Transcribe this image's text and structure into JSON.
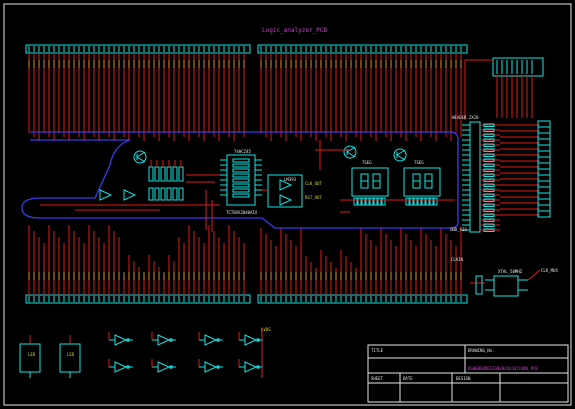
{
  "schematic": {
    "title": "Logic_analyzer_PCB",
    "ic_labels": {
      "u1": "74HC245",
      "u1_part": "TCT8XX2040AIX",
      "comparator": "LM393",
      "display_1": "7SEG",
      "display_2": "7SEG",
      "connector_right": "HEADER 2X20",
      "oscillator": "XTAL_50MHZ",
      "clk": "CLK_OUT",
      "rst": "RST_OUT"
    },
    "net_labels": {
      "gnd_right": "GND_SIG",
      "clk_in": "CLKIN",
      "clk_mux": "CLK_MUX",
      "vcc": "VCC",
      "lvds": "LVDS"
    },
    "led_labels": [
      "LED",
      "LED"
    ]
  },
  "title_block": {
    "title_label": "TITLE",
    "drawing_no_label": "DRAWING_No.",
    "drawing_no_value": "KSWEBGRDESIGN2024LOGICANA_PCB",
    "sheet_label": "SHEET",
    "date_label": "DATE",
    "design_label": "DESIGN"
  },
  "colors": {
    "background": "#000000",
    "component": "#16e3e3",
    "wire": "#e11b1b",
    "bus": "#3a3ae8",
    "text": "#d8d820",
    "title": "#d040d0",
    "border": "#e6e6e6",
    "white": "#e6e6e6"
  }
}
